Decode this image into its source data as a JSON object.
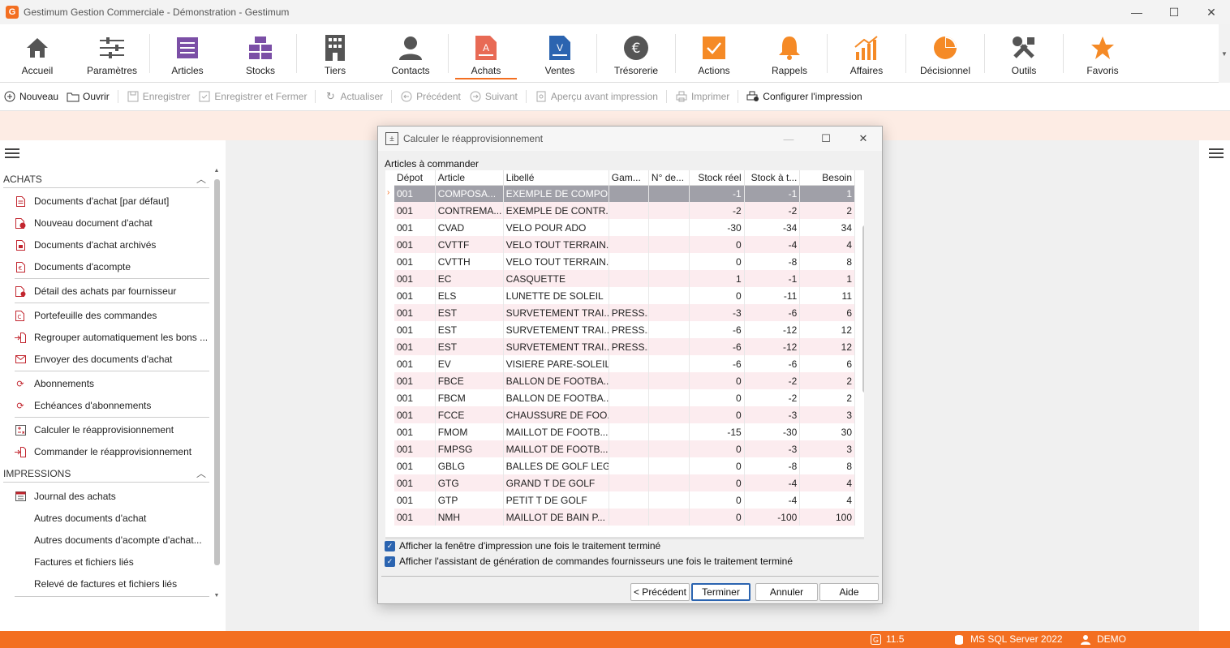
{
  "window": {
    "title": "Gestimum Gestion Commerciale - Démonstration - Gestimum",
    "logo_letter": "G",
    "minimize": "—",
    "maximize": "☐",
    "close": "✕"
  },
  "ribbon": {
    "items": [
      {
        "label": "Accueil",
        "icon": "home-icon",
        "color": "#555555"
      },
      {
        "label": "Paramètres",
        "icon": "sliders-icon",
        "color": "#555555"
      },
      {
        "label": "Articles",
        "icon": "list-icon",
        "color": "#7b4fa6"
      },
      {
        "label": "Stocks",
        "icon": "grid-icon",
        "color": "#7b4fa6"
      },
      {
        "label": "Tiers",
        "icon": "building-icon",
        "color": "#555555"
      },
      {
        "label": "Contacts",
        "icon": "person-icon",
        "color": "#555555"
      },
      {
        "label": "Achats",
        "icon": "document-a-icon",
        "color": "#e86a55"
      },
      {
        "label": "Ventes",
        "icon": "document-v-icon",
        "color": "#2b64b0"
      },
      {
        "label": "Trésorerie",
        "icon": "euro-icon",
        "color": "#555555"
      },
      {
        "label": "Actions",
        "icon": "check-icon",
        "color": "#f58a26"
      },
      {
        "label": "Rappels",
        "icon": "bell-icon",
        "color": "#f58a26"
      },
      {
        "label": "Affaires",
        "icon": "growth-icon",
        "color": "#f58a26"
      },
      {
        "label": "Décisionnel",
        "icon": "pie-icon",
        "color": "#f58a26"
      },
      {
        "label": "Outils",
        "icon": "tools-icon",
        "color": "#555555"
      },
      {
        "label": "Favoris",
        "icon": "star-icon",
        "color": "#f58a26"
      }
    ],
    "scroll_arrow": "▼"
  },
  "toolbar": {
    "nouveau": "Nouveau",
    "ouvrir": "Ouvrir",
    "enregistrer": "Enregistrer",
    "enregistrer_fermer": "Enregistrer et Fermer",
    "actualiser": "Actualiser",
    "precedent": "Précédent",
    "suivant": "Suivant",
    "apercu": "Aperçu avant impression",
    "imprimer": "Imprimer",
    "configurer": "Configurer l'impression"
  },
  "sidebar": {
    "achats_header": "ACHATS",
    "impressions_header": "IMPRESSIONS",
    "achats_items": [
      {
        "label": "Documents d'achat [par défaut]",
        "icon": "document-icon"
      },
      {
        "label": "Nouveau document d'achat",
        "icon": "new-document-icon"
      },
      {
        "label": "Documents d'achat archivés",
        "icon": "archive-icon"
      },
      {
        "label": "Documents d'acompte",
        "icon": "euro-document-icon"
      },
      {
        "label": "Détail des achats par fournisseur",
        "icon": "detail-icon"
      },
      {
        "label": "Portefeuille des commandes",
        "icon": "portfolio-icon"
      },
      {
        "label": "Regrouper automatiquement les bons ...",
        "icon": "merge-icon"
      },
      {
        "label": "Envoyer des documents d'achat",
        "icon": "mail-icon"
      },
      {
        "label": "Abonnements",
        "icon": "refresh-icon"
      },
      {
        "label": "Echéances d'abonnements",
        "icon": "schedule-icon"
      },
      {
        "label": "Calculer le réapprovisionnement",
        "icon": "calculator-icon"
      },
      {
        "label": "Commander le réapprovisionnement",
        "icon": "order-icon"
      }
    ],
    "impressions_items": [
      {
        "label": "Journal des achats"
      },
      {
        "label": "Autres documents d'achat"
      },
      {
        "label": "Autres documents d'acompte d'achat..."
      },
      {
        "label": "Factures et fichiers liés"
      },
      {
        "label": "Relevé de factures et fichiers liés"
      }
    ]
  },
  "dialog": {
    "title": "Calculer le réapprovisionnement",
    "group_label": "Articles à commander",
    "columns": [
      "Dépot",
      "Article",
      "Libellé",
      "Gam...",
      "N° de...",
      "Stock réel",
      "Stock à t...",
      "Besoin"
    ],
    "rows": [
      [
        "001",
        "COMPOSA...",
        "EXEMPLE DE COMPO...",
        "",
        "",
        "-1",
        "-1",
        "1"
      ],
      [
        "001",
        "CONTREMA...",
        "EXEMPLE DE CONTR...",
        "",
        "",
        "-2",
        "-2",
        "2"
      ],
      [
        "001",
        "CVAD",
        "VELO POUR ADO",
        "",
        "",
        "-30",
        "-34",
        "34"
      ],
      [
        "001",
        "CVTTF",
        "VELO TOUT TERRAIN...",
        "",
        "",
        "0",
        "-4",
        "4"
      ],
      [
        "001",
        "CVTTH",
        "VELO TOUT TERRAIN...",
        "",
        "",
        "0",
        "-8",
        "8"
      ],
      [
        "001",
        "EC",
        "CASQUETTE",
        "",
        "",
        "1",
        "-1",
        "1"
      ],
      [
        "001",
        "ELS",
        "LUNETTE DE SOLEIL",
        "",
        "",
        "0",
        "-11",
        "11"
      ],
      [
        "001",
        "EST",
        "SURVETEMENT TRAI...",
        "PRESS...",
        "",
        "-3",
        "-6",
        "6"
      ],
      [
        "001",
        "EST",
        "SURVETEMENT TRAI...",
        "PRESS...",
        "",
        "-6",
        "-12",
        "12"
      ],
      [
        "001",
        "EST",
        "SURVETEMENT TRAI...",
        "PRESS...",
        "",
        "-6",
        "-12",
        "12"
      ],
      [
        "001",
        "EV",
        "VISIERE PARE-SOLEIL",
        "",
        "",
        "-6",
        "-6",
        "6"
      ],
      [
        "001",
        "FBCE",
        "BALLON DE FOOTBA...",
        "",
        "",
        "0",
        "-2",
        "2"
      ],
      [
        "001",
        "FBCM",
        "BALLON DE FOOTBA...",
        "",
        "",
        "0",
        "-2",
        "2"
      ],
      [
        "001",
        "FCCE",
        "CHAUSSURE DE FOO...",
        "",
        "",
        "0",
        "-3",
        "3"
      ],
      [
        "001",
        "FMOM",
        "MAILLOT DE FOOTB...",
        "",
        "",
        "-15",
        "-30",
        "30"
      ],
      [
        "001",
        "FMPSG",
        "MAILLOT DE FOOTB...",
        "",
        "",
        "0",
        "-3",
        "3"
      ],
      [
        "001",
        "GBLG",
        "BALLES DE GOLF LEG...",
        "",
        "",
        "0",
        "-8",
        "8"
      ],
      [
        "001",
        "GTG",
        "GRAND T DE GOLF",
        "",
        "",
        "0",
        "-4",
        "4"
      ],
      [
        "001",
        "GTP",
        "PETIT T DE GOLF",
        "",
        "",
        "0",
        "-4",
        "4"
      ],
      [
        "001",
        "NMH",
        "MAILLOT DE BAIN P...",
        "",
        "",
        "0",
        "-100",
        "100"
      ]
    ],
    "checkbox1": "Afficher la fenêtre d'impression une fois le traitement terminé",
    "checkbox2": "Afficher l'assistant de génération de commandes fournisseurs une fois le traitement terminé",
    "btn_prev": "< Précédent",
    "btn_finish": "Terminer",
    "btn_cancel": "Annuler",
    "btn_help": "Aide"
  },
  "status": {
    "version": "11.5",
    "db": "MS SQL Server 2022",
    "user": "DEMO"
  },
  "colors": {
    "accent": "#f36f21",
    "selection": "#a0a0a8",
    "alt_row": "#fcecef"
  }
}
